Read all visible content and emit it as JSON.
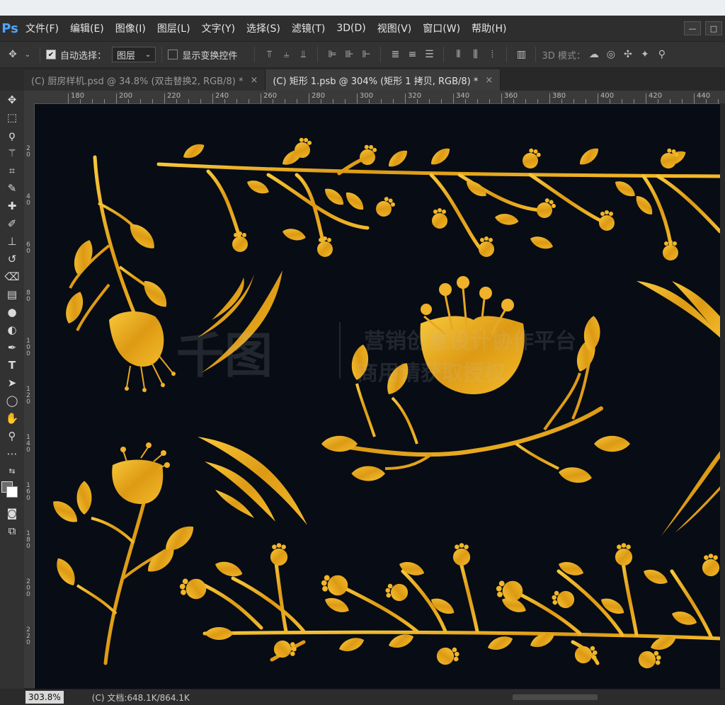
{
  "app": {
    "logo": "Ps",
    "brand_color": "#4ea6ff"
  },
  "menu": [
    "文件(F)",
    "编辑(E)",
    "图像(I)",
    "图层(L)",
    "文字(Y)",
    "选择(S)",
    "滤镜(T)",
    "3D(D)",
    "视图(V)",
    "窗口(W)",
    "帮助(H)"
  ],
  "window_controls": {
    "minimize": "—",
    "restore": "□"
  },
  "options": {
    "auto_select_label": "自动选择：",
    "auto_select_checked": true,
    "layer_dropdown_value": "图层",
    "show_transform_label": "显示变换控件",
    "show_transform_checked": false,
    "mode_3d_label": "3D 模式："
  },
  "tabs": [
    {
      "title": "(C) 厨房样机.psd @ 34.8% (双击替换2, RGB/8) *",
      "active": false
    },
    {
      "title": "(C) 矩形 1.psb @ 304% (矩形 1 拷贝, RGB/8) *",
      "active": true
    }
  ],
  "ruler": {
    "h_labels": [
      "180",
      "200",
      "220",
      "240",
      "260",
      "280",
      "300",
      "320",
      "340",
      "360",
      "380",
      "400",
      "420",
      "440"
    ],
    "v_labels": [
      "20",
      "40",
      "60",
      "80",
      "100",
      "120",
      "140",
      "160",
      "180",
      "200",
      "220"
    ]
  },
  "watermark": {
    "logo_text": "千图",
    "line1": "营销创意设计协作平台",
    "line2": "商用请获取授权"
  },
  "canvas": {
    "background": "#080c15",
    "gold": "#e0a21a",
    "gold_light": "#f6c232"
  },
  "status": {
    "zoom": "303.8%",
    "doc_info": "(C) 文档:648.1K/864.1K"
  },
  "tools": [
    "move-icon",
    "marquee-icon",
    "lasso-icon",
    "magic-wand-icon",
    "crop-icon",
    "eyedropper-icon",
    "healing-icon",
    "brush-icon",
    "stamp-icon",
    "history-brush-icon",
    "eraser-icon",
    "gradient-icon",
    "blur-icon",
    "dodge-icon",
    "pen-icon",
    "type-icon",
    "path-select-icon",
    "shape-icon",
    "hand-icon",
    "zoom-icon",
    "more-icon"
  ]
}
